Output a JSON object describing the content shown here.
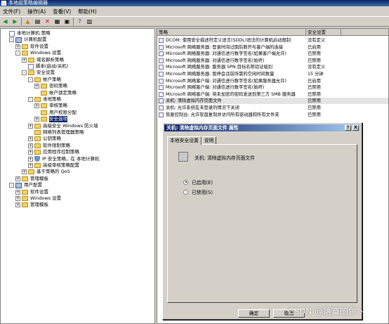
{
  "window": {
    "title": "本地组策略编辑器"
  },
  "menu": [
    "文件(F)",
    "操作(A)",
    "查看(V)",
    "帮助(H)"
  ],
  "tree": [
    {
      "label": "本地计算机 策略",
      "indent": 0,
      "icon": "doc",
      "exp": ""
    },
    {
      "label": "计算机配置",
      "indent": 1,
      "icon": "comp",
      "exp": "-"
    },
    {
      "label": "软件设置",
      "indent": 2,
      "icon": "folder",
      "exp": "+"
    },
    {
      "label": "Windows 设置",
      "indent": 2,
      "icon": "folder",
      "exp": "-"
    },
    {
      "label": "域名解析策略",
      "indent": 3,
      "icon": "folder",
      "exp": "+"
    },
    {
      "label": "脚本(启动/关机)",
      "indent": 3,
      "icon": "doc",
      "exp": ""
    },
    {
      "label": "安全设置",
      "indent": 3,
      "icon": "folder",
      "exp": "-"
    },
    {
      "label": "帐户策略",
      "indent": 4,
      "icon": "folder",
      "exp": "-"
    },
    {
      "label": "密码策略",
      "indent": 5,
      "icon": "folder",
      "exp": "+"
    },
    {
      "label": "帐户锁定策略",
      "indent": 5,
      "icon": "folder",
      "exp": ""
    },
    {
      "label": "本地策略",
      "indent": 4,
      "icon": "folder",
      "exp": "-"
    },
    {
      "label": "审核策略",
      "indent": 5,
      "icon": "folder",
      "exp": "+"
    },
    {
      "label": "用户权限分配",
      "indent": 5,
      "icon": "folder",
      "exp": ""
    },
    {
      "label": "安全选项",
      "indent": 5,
      "icon": "folder",
      "exp": "+",
      "selected": true
    },
    {
      "label": "高级安全 Windows 防火墙",
      "indent": 4,
      "icon": "folder",
      "exp": "+"
    },
    {
      "label": "网络列表管理器策略",
      "indent": 4,
      "icon": "folder",
      "exp": ""
    },
    {
      "label": "公钥策略",
      "indent": 4,
      "icon": "folder",
      "exp": "+"
    },
    {
      "label": "软件限制策略",
      "indent": 4,
      "icon": "folder",
      "exp": "+"
    },
    {
      "label": "应用程序控制策略",
      "indent": 4,
      "icon": "folder",
      "exp": "+"
    },
    {
      "label": "IP 安全策略，在 本地计算机",
      "indent": 4,
      "icon": "shield",
      "exp": "+"
    },
    {
      "label": "高级审核策略配置",
      "indent": 4,
      "icon": "folder",
      "exp": "+"
    },
    {
      "label": "基于策略的 QoS",
      "indent": 3,
      "icon": "folder",
      "exp": "+"
    },
    {
      "label": "管理模板",
      "indent": 2,
      "icon": "folder",
      "exp": "+"
    },
    {
      "label": "用户配置",
      "indent": 1,
      "icon": "comp",
      "exp": "-"
    },
    {
      "label": "软件设置",
      "indent": 2,
      "icon": "folder",
      "exp": "+"
    },
    {
      "label": "Windows 设置",
      "indent": 2,
      "icon": "folder",
      "exp": "+"
    },
    {
      "label": "管理模板",
      "indent": 2,
      "icon": "folder",
      "exp": "+"
    }
  ],
  "list": {
    "col_policy": "策略",
    "col_setting": "安全设置",
    "rows": [
      {
        "policy": "DCOM: 使用安全描述符定义语言(SDDL)语法的计算机启动限制",
        "setting": "没有定义"
      },
      {
        "policy": "Microsoft 网络服务器: 登录时间过期后断开与客户端的连接",
        "setting": "已启用"
      },
      {
        "policy": "Microsoft 网络服务器: 对通信进行数字签名(如果客户端允许)",
        "setting": "已禁用"
      },
      {
        "policy": "Microsoft 网络服务器: 对通信进行数字签名(始终)",
        "setting": "已禁用"
      },
      {
        "policy": "Microsoft 网络服务器: 服务器 SPN 目标名称验证级别",
        "setting": "没有定义"
      },
      {
        "policy": "Microsoft 网络服务器: 暂停会话前所需的空闲时间数量",
        "setting": "15 分钟"
      },
      {
        "policy": "Microsoft 网络客户端: 对通信进行数字签名(如果服务器允许)",
        "setting": "已启用"
      },
      {
        "policy": "Microsoft 网络客户端: 对通信进行数字签名(始终)",
        "setting": "已禁用"
      },
      {
        "policy": "Microsoft 网络客户端: 将未加密的密码发送到第三方 SMB 服务器",
        "setting": "已禁用"
      },
      {
        "policy": "关机: 清除虚拟内存页面文件",
        "setting": "已禁用",
        "hl": true
      },
      {
        "policy": "关机: 允许系统在未登录的情况下关闭",
        "setting": "已禁用"
      },
      {
        "policy": "恢复控制台: 允许软盘复制并访问所有驱动器和所有文件夹",
        "setting": "已禁用"
      }
    ]
  },
  "dialog": {
    "title": "关机: 清除虚拟内存页面文件 属性",
    "help": "?",
    "close": "X",
    "tabs": [
      "本地安全设置",
      "说明"
    ],
    "policy_name": "关机: 清除虚拟内存页面文件",
    "enabled_label": "已启用(E)",
    "disabled_label": "已禁用(S)",
    "ok": "确定",
    "cancel": "取消"
  },
  "watermark": "CSDN @落寞的鱼丶"
}
